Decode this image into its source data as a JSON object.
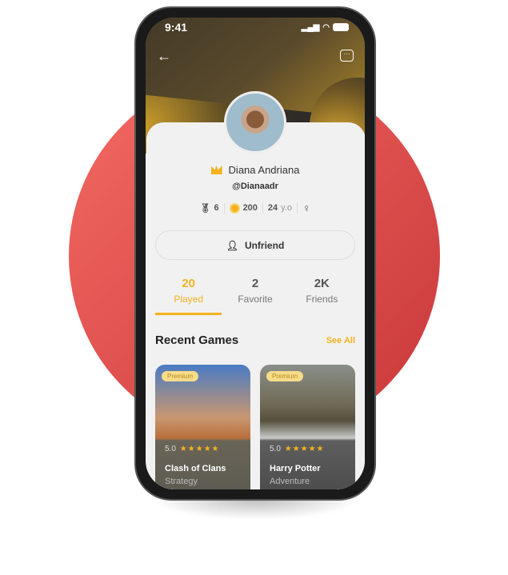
{
  "status": {
    "time": "9:41"
  },
  "profile": {
    "name": "Diana Andriana",
    "handle": "@Dianaadr"
  },
  "stats": {
    "awards": "6",
    "coins": "200",
    "age": "24",
    "age_unit": "y.o"
  },
  "unfriend_label": "Unfriend",
  "tabs": [
    {
      "count": "20",
      "label": "Played"
    },
    {
      "count": "2",
      "label": "Favorite"
    },
    {
      "count": "2K",
      "label": "Friends"
    }
  ],
  "recent": {
    "title": "Recent Games",
    "see_all": "See All"
  },
  "games": [
    {
      "badge": "Premium",
      "rating": "5.0",
      "stars": "★★★★★",
      "title": "Clash of Clans",
      "genre": "Strategy"
    },
    {
      "badge": "Premium",
      "rating": "5.0",
      "stars": "★★★★★",
      "title": "Harry Potter",
      "genre": "Adventure"
    }
  ],
  "colors": {
    "accent": "#f3b21f",
    "background_circle": "#e0494a"
  }
}
